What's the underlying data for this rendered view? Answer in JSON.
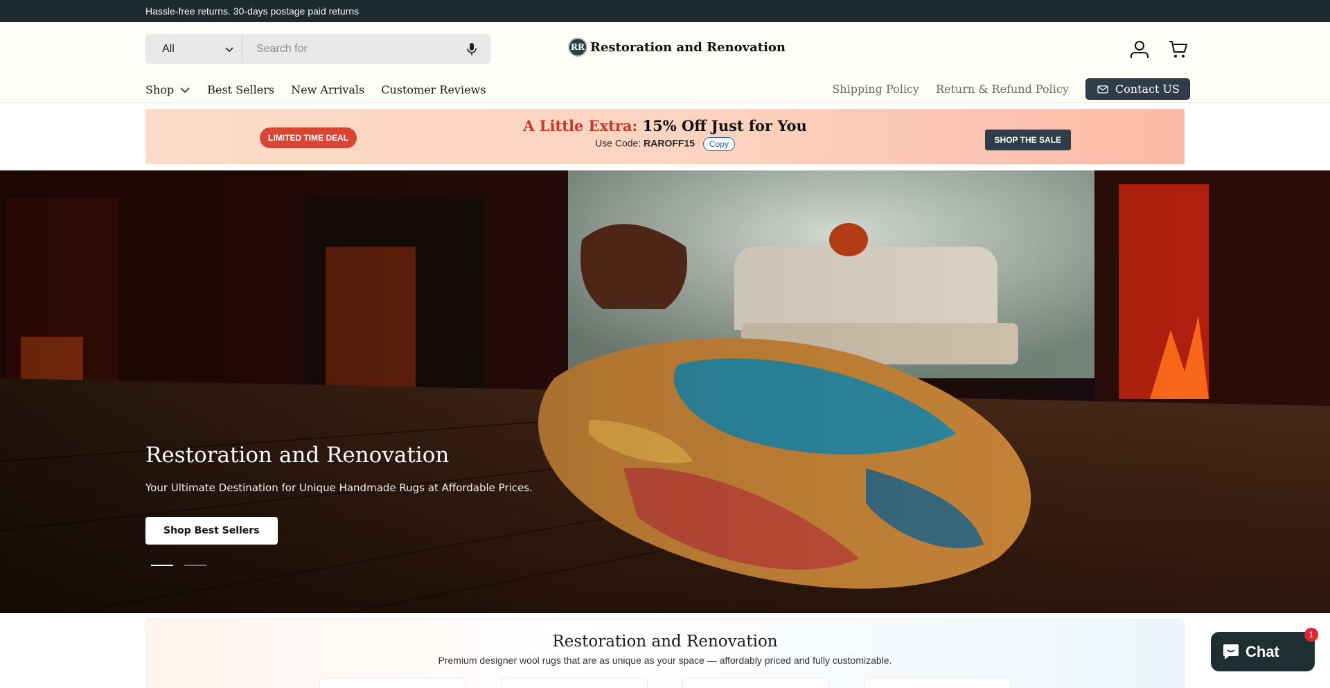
{
  "announcement": {
    "text": "Hassle-free returns. 30-days postage paid returns"
  },
  "header": {
    "search": {
      "category": "All",
      "placeholder": "Search for"
    },
    "logo": {
      "mark": "RR",
      "text": "Restoration and Renovation"
    },
    "icons": [
      "user-icon",
      "cart-icon"
    ]
  },
  "nav": {
    "items": [
      {
        "label": "Shop"
      },
      {
        "label": "Best Sellers"
      },
      {
        "label": "New Arrivals"
      },
      {
        "label": "Customer Reviews"
      }
    ],
    "links": [
      {
        "label": "Shipping Policy"
      },
      {
        "label": "Return & Refund Policy"
      }
    ],
    "contact_label": "Contact US"
  },
  "promo": {
    "badge": "LIMITED TIME DEAL",
    "title_highlight": "A Little Extra:",
    "title_rest": "15% Off Just for You",
    "code_label": "Use Code:",
    "code": "RAROFF15",
    "copy_label": "Copy",
    "cta": "SHOP THE SALE"
  },
  "hero": {
    "title": "Restoration and Renovation",
    "subtitle": "Your Ultimate Destination for Unique Handmade Rugs at Affordable Prices.",
    "button": "Shop Best Sellers",
    "slides": 2,
    "active_slide": 1
  },
  "intro": {
    "title": "Restoration and Renovation",
    "subtitle": "Premium designer wool rugs that are as unique as your space — affordably priced and fully customizable."
  },
  "chat": {
    "label": "Chat",
    "badge": "1"
  },
  "colors": {
    "announce_bg": "#1c2b2d",
    "accent_dark": "#2f3c4a",
    "deal_red": "#d94535",
    "chat_bg": "#1f2e30"
  }
}
